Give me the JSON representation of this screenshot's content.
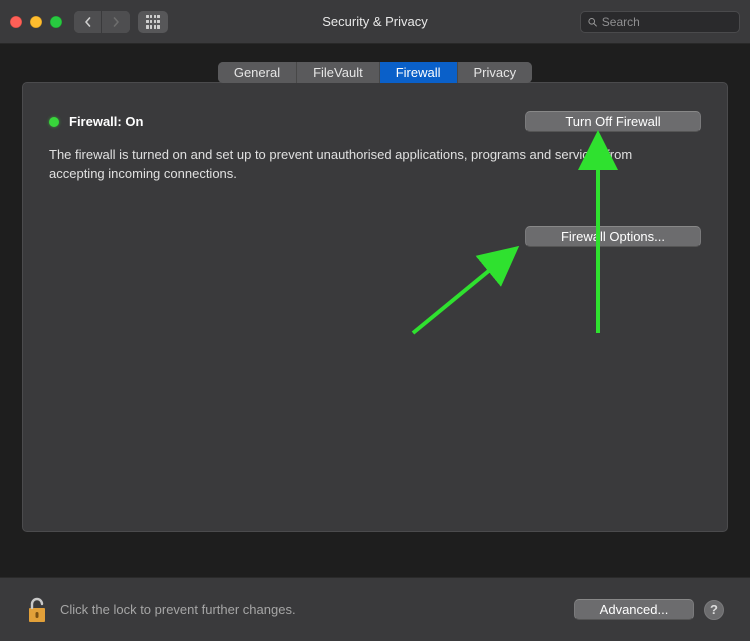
{
  "window": {
    "title": "Security & Privacy",
    "search_placeholder": "Search"
  },
  "tabs": [
    {
      "label": "General",
      "active": false
    },
    {
      "label": "FileVault",
      "active": false
    },
    {
      "label": "Firewall",
      "active": true
    },
    {
      "label": "Privacy",
      "active": false
    }
  ],
  "firewall": {
    "status_label": "Firewall: On",
    "status_color": "#38d73b",
    "turn_off_label": "Turn Off Firewall",
    "description": "The firewall is turned on and set up to prevent unauthorised applications, programs and services from accepting incoming connections.",
    "options_label": "Firewall Options..."
  },
  "footer": {
    "lock_text": "Click the lock to prevent further changes.",
    "advanced_label": "Advanced...",
    "help_label": "?"
  },
  "annotations": {
    "arrow_color": "#2fe12f"
  }
}
